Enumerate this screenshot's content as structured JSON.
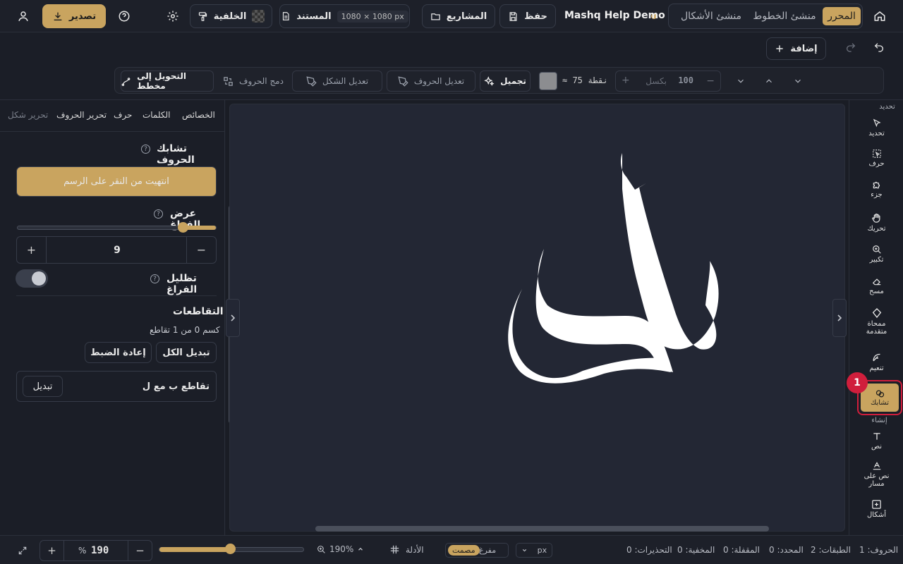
{
  "topbar": {
    "tabs": [
      {
        "label": "المحرر",
        "active": true
      },
      {
        "label": "منشئ الخطوط",
        "active": false
      },
      {
        "label": "منشئ الأشكال",
        "active": false
      }
    ],
    "project_name": "Mashq Help Demo",
    "save_label": "حفظ",
    "projects_label": "المشاريع",
    "document_label": "المستند",
    "document_size": "1080 × 1080 px",
    "background_label": "الخلفية",
    "export_label": "تصدير"
  },
  "actions": {
    "add_label": "إضافة"
  },
  "toolbar": {
    "size_value": "100",
    "size_unit": "بكسل",
    "approx_points": "≈ 75 نقطة",
    "color_hex": "#8c8d90",
    "beautify_label": "تجميل",
    "edit_letters_label": "تعديل الحروف",
    "edit_shape_label": "تعديل الشكل",
    "merge_letters_label": "دمج الحروف",
    "to_outline_label": "التحويل إلى مخطط"
  },
  "panel": {
    "tabs": [
      "الخصائص",
      "الكلمات",
      "حرف",
      "تحرير الحروف",
      "تحرير شكل"
    ],
    "interlock_title": "تشابك الحروف",
    "finish_button": "انتهيت من النقر على الرسم",
    "gap_width_label": "عرض الفراغ",
    "gap_width_value": "9",
    "gap_width_fraction": 0.17,
    "shade_gap_label": "تظليل الفراغ",
    "shade_gap_on": false,
    "intersections_title": "التقاطعات",
    "intersections_summary": "كسم 0 من 1 تقاطع",
    "swap_all_label": "تبديل الكل",
    "reset_label": "إعادة الضبط",
    "intersection_item": "تقاطع ب مع ل",
    "swap_label": "تبديل"
  },
  "canvas": {
    "glyph_text": "بل",
    "glyph_color": "#ffffff"
  },
  "rail": {
    "group_select": "تحديد",
    "group_create": "إنشاء",
    "tools": [
      {
        "label": "تحديد",
        "icon": "cursor-icon"
      },
      {
        "label": "حرف",
        "icon": "letter-select-icon"
      },
      {
        "label": "جزء",
        "icon": "puzzle-icon"
      },
      {
        "label": "تحريك",
        "icon": "hand-icon"
      },
      {
        "label": "تكبير",
        "icon": "zoom-icon"
      },
      {
        "label": "مسح",
        "icon": "eraser-icon"
      },
      {
        "label": "ممحاة متقدمة",
        "icon": "advanced-eraser-icon"
      },
      {
        "label": "تنعيم",
        "icon": "feather-icon"
      },
      {
        "label": "تشابك",
        "icon": "interlock-icon",
        "active": true,
        "badge": "1"
      },
      {
        "label": "نص",
        "icon": "text-icon"
      },
      {
        "label": "نص على مسار",
        "icon": "text-on-path-icon"
      },
      {
        "label": "أشكال",
        "icon": "shapes-icon"
      }
    ]
  },
  "status": {
    "letters": "الحروف: 1",
    "layers": "الطبقات: 2",
    "selected": "المحدد: 0",
    "locked": "المقفلة: 0",
    "hidden": "المخفية: 0",
    "warnings": "التحذيرات: 0",
    "unit": "px",
    "hollow_label": "مفرغ",
    "solid_label": "مصمت",
    "guides_label": "الأدلة",
    "zoom_readout": "190%",
    "zoom_fraction": 0.49,
    "zoom_value": "190",
    "zoom_unit": "%"
  },
  "colors": {
    "accent": "#c9a45f",
    "badge": "#d01e3c",
    "background": "#1b1e27"
  }
}
